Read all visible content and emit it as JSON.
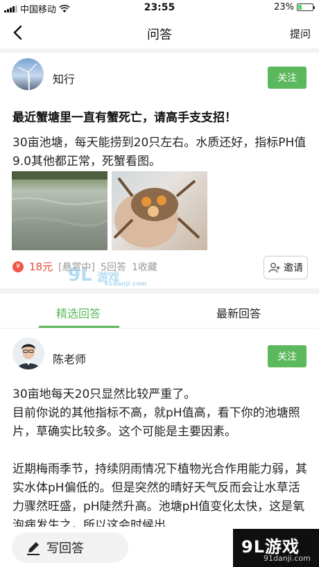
{
  "status_bar": {
    "carrier": "中国移动",
    "time": "23:55",
    "battery_pct": "23%",
    "battery_level": 0.23
  },
  "nav": {
    "title": "问答",
    "ask_label": "提问"
  },
  "question": {
    "author": "知行",
    "follow_label": "关注",
    "title": "最近蟹塘里一直有蟹死亡，请高手支支招！",
    "body": "30亩池塘，每天能捞到20只左右。水质还好，指标PH值9.0其他都正常，死蟹看图。",
    "reward": "18元",
    "reward_status": "[悬赏中]",
    "answers_count": "5回答",
    "favorites_count": "1收藏",
    "invite_label": "邀请"
  },
  "tabs": {
    "selected": "精选回答",
    "latest": "最新回答"
  },
  "answer": {
    "author": "陈老师",
    "follow_label": "关注",
    "para1": "30亩地每天20只显然比较严重了。",
    "para2": "目前你说的其他指标不高，就pH值高，看下你的池塘照片，草确实比较多。这个可能是主要因素。",
    "para3": "近期梅雨季节，持续阴雨情况下植物光合作用能力弱，其实水体pH偏低的。但是突然的晴好天气反而会让水草活力骤然旺盛，pH陡然升高。池塘pH值变化太快，这是氧泡病发生之，所以这会时候出"
  },
  "bottom": {
    "write_label": "写回答"
  },
  "watermarks": {
    "corner_line1": "9L游戏",
    "corner_line2": "91danji.com",
    "center_line1": "9L",
    "center_line2": "游戏",
    "center_line3": "91danji.com"
  },
  "colors": {
    "accent_green": "#5cb85c",
    "reward_red": "#e8473a"
  }
}
